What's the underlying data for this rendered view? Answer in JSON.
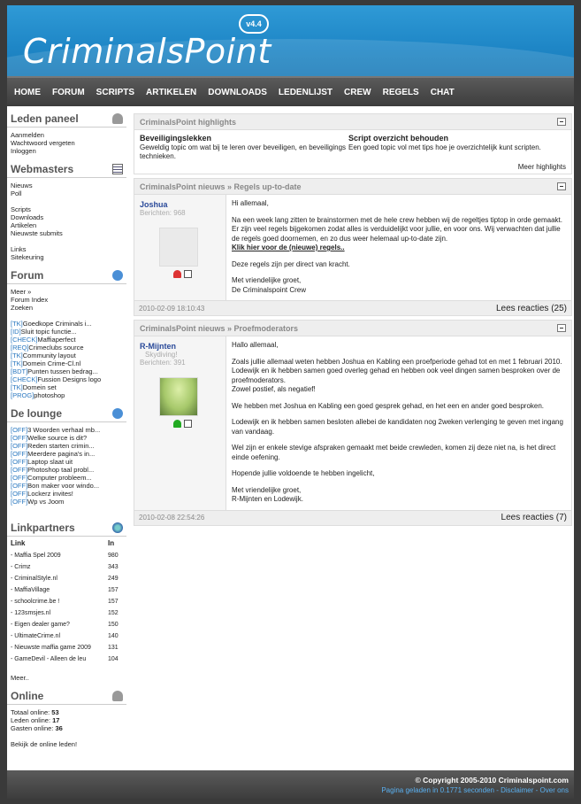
{
  "logo": {
    "text": "CriminalsPoint",
    "version": "v4.4"
  },
  "nav": [
    "HOME",
    "FORUM",
    "SCRIPTS",
    "ARTIKELEN",
    "DOWNLOADS",
    "LEDENLIJST",
    "CREW",
    "REGELS",
    "CHAT"
  ],
  "leden_paneel": {
    "title": "Leden paneel",
    "items": [
      "Aanmelden",
      "Wachtwoord vergeten",
      "Inloggen"
    ]
  },
  "webmasters": {
    "title": "Webmasters",
    "group1": [
      "Nieuws",
      "Poll"
    ],
    "group2": [
      "Scripts",
      "Downloads",
      "Artikelen",
      "Nieuwste submits"
    ],
    "group3": [
      "Links",
      "Sitekeuring"
    ]
  },
  "forum": {
    "title": "Forum",
    "items": [
      "Meer »",
      "Forum Index",
      "Zoeken"
    ],
    "topics": [
      {
        "tag": "[TK]",
        "text": "Goedkope Criminals i..."
      },
      {
        "tag": "[ID]",
        "text": "Sluit topic functie..."
      },
      {
        "tag": "[CHECK]",
        "text": "Maffiaperfect"
      },
      {
        "tag": "[REQ]",
        "text": "Crimeclubs source"
      },
      {
        "tag": "[TK]",
        "text": "Community layout"
      },
      {
        "tag": "[TK]",
        "text": "Domein Crime-Cl.nl"
      },
      {
        "tag": "[BDT]",
        "text": "Punten tussen bedrag..."
      },
      {
        "tag": "[CHECK]",
        "text": "Fussion Designs logo"
      },
      {
        "tag": "[TK]",
        "text": "Domein set"
      },
      {
        "tag": "[PROG]",
        "text": "photoshop"
      }
    ]
  },
  "lounge": {
    "title": "De lounge",
    "topics": [
      {
        "tag": "[OFF]",
        "text": "3 Woorden verhaal mb..."
      },
      {
        "tag": "[OFF]",
        "text": "Welke source is dit?"
      },
      {
        "tag": "[OFF]",
        "text": "Reden starten crimin..."
      },
      {
        "tag": "[OFF]",
        "text": "Meerdere pagina's in..."
      },
      {
        "tag": "[OFF]",
        "text": "Laptop slaat uit"
      },
      {
        "tag": "[OFF]",
        "text": "Photoshop taal probl..."
      },
      {
        "tag": "[OFF]",
        "text": "Computer probleem..."
      },
      {
        "tag": "[OFF]",
        "text": "Bon maker voor windo..."
      },
      {
        "tag": "[OFF]",
        "text": "Lockerz invites!"
      },
      {
        "tag": "[OFF]",
        "text": "Wp vs Joom"
      }
    ]
  },
  "linkpartners": {
    "title": "Linkpartners",
    "col_link": "Link",
    "col_in": "In",
    "rows": [
      {
        "name": "- Maffia Spel 2009",
        "in": "980"
      },
      {
        "name": "- Crimz",
        "in": "343"
      },
      {
        "name": "- CriminalStyle.nl",
        "in": "249"
      },
      {
        "name": "- MaffiaVillage",
        "in": "157"
      },
      {
        "name": "- schoolcrime.be !",
        "in": "157"
      },
      {
        "name": "- 123smsjes.nl",
        "in": "152"
      },
      {
        "name": "- Eigen dealer game?",
        "in": "150"
      },
      {
        "name": "- UltimateCrime.nl",
        "in": "140"
      },
      {
        "name": "- Nieuwste maffia game 2009",
        "in": "131"
      },
      {
        "name": "- GameDevil - Alleen de leu",
        "in": "104"
      }
    ],
    "more": "Meer.."
  },
  "online": {
    "title": "Online",
    "totaal_label": "Totaal online:",
    "totaal": "53",
    "leden_label": "Leden online:",
    "leden": "17",
    "gasten_label": "Gasten online:",
    "gasten": "36",
    "link": "Bekijk de online leden!"
  },
  "highlights": {
    "title": "CriminalsPoint highlights",
    "items": [
      {
        "title": "Beveiligingslekken",
        "text": "Geweldig topic om wat bij te leren over beveiligen, en beveiligings technieken."
      },
      {
        "title": "Script overzicht behouden",
        "text": "Een goed topic vol met tips hoe je overzichtelijk kunt scripten."
      }
    ],
    "more": "Meer highlights"
  },
  "news1": {
    "title": "CriminalsPoint nieuws » Regels up-to-date",
    "author": "Joshua",
    "author_sub": "",
    "posts": "Berichten: 968",
    "p1": "Hi allemaal,",
    "p2": "Na een week lang zitten te brainstormen met de hele crew hebben wij de regeltjes tiptop in orde gemaakt. Er zijn veel regels bijgekomen zodat alles is verduidelijkt voor jullie, en voor ons. Wij verwachten dat jullie de regels goed doornemen, en zo dus weer helemaal up-to-date zijn.",
    "link": "Klik hier voor de (nieuwe) regels..",
    "p3": "Deze regels zijn per direct van kracht.",
    "p4a": "Met vriendelijke groet,",
    "p4b": "De Criminalspoint Crew",
    "date": "2010-02-09 18:10:43",
    "reacties": "Lees reacties (25)"
  },
  "news2": {
    "title": "CriminalsPoint nieuws » Proefmoderators",
    "author": "R-Mijnten",
    "author_sub": "Skydiving!",
    "posts": "Berichten: 391",
    "p1": "Hallo allemaal,",
    "p2a": "Zoals jullie allemaal weten hebben Joshua en Kabling een proefperiode gehad tot en met 1 februari 2010.",
    "p2b": "Lodewijk en ik hebben samen goed overleg gehad en hebben ook veel dingen samen besproken over de proefmoderators.",
    "p2c": "Zowel postief, als negatief!",
    "p3": "We hebben met Joshua en Kabling een goed gesprek gehad, en het een en ander goed besproken.",
    "p4": "Lodewijk en ik hebben samen besloten allebei de kandidaten nog 2weken verlenging te geven met ingang van vandaag.",
    "p5": "Wel zijn er enkele stevige afspraken gemaakt met beide crewleden, komen zij deze niet na, is het direct einde oefening.",
    "p6": "Hopende jullie voldoende te hebben ingelicht,",
    "p7a": "Met vriendelijke groet,",
    "p7b": "R-Mijnten en Lodewijk.",
    "date": "2010-02-08 22:54:26",
    "reacties": "Lees reacties (7)"
  },
  "footer": {
    "copyright": "© Copyright  2005-2010  Criminalspoint.com",
    "info": "Pagina geladen in 0.1771 seconden - Disclaimer - Over ons"
  }
}
